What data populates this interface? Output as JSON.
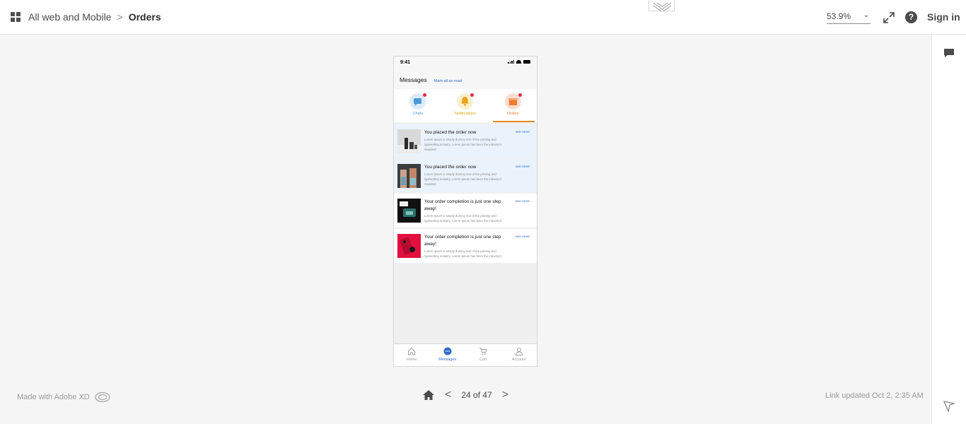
{
  "breadcrumb": {
    "project": "All web and Mobile",
    "separator": ">",
    "current": "Orders"
  },
  "toolbar": {
    "zoom": "53.9%",
    "sign_in": "Sign in",
    "help": "?"
  },
  "icons": {
    "grid": "grid-icon",
    "expand": "expand-icon",
    "help": "help-icon",
    "comment": "comment-icon",
    "flag": "flag-icon",
    "home": "home-icon",
    "collapse": "chevron-up-icon",
    "creative_cloud": "creative-cloud-icon"
  },
  "phone": {
    "time": "9:41",
    "header": {
      "title": "Messages",
      "mark_all": "Mark all as read"
    },
    "tabs": [
      {
        "label": "Chats",
        "color": "#4a9ad8",
        "bg": "#dcebf8"
      },
      {
        "label": "Notifications",
        "color": "#e8a316",
        "bg": "#fcefcc"
      },
      {
        "label": "Orders",
        "color": "#f07a2a",
        "bg": "#fbdcd4"
      }
    ],
    "items": [
      {
        "title": "You placed the order now",
        "body": "Lorem Ipsum is simply dummy text of the printing and typesetting industry. Lorem Ipsum has been the industry's standard",
        "more": "see more"
      },
      {
        "title": "You placed the order now",
        "body": "Lorem Ipsum is simply dummy text of the printing and typesetting industry. Lorem Ipsum has been the industry's standard",
        "more": "see more"
      },
      {
        "title": "Your order completion is just one step away!",
        "body": "Lorem Ipsum is simply dummy text of the printing and typesetting industry. Lorem Ipsum has been the industry's",
        "more": "see more"
      },
      {
        "title": "Your order completion is just one step away!",
        "body": "Lorem Ipsum is simply dummy text of the printing and typesetting industry. Lorem Ipsum has been the industry's",
        "more": "see more"
      }
    ],
    "tabbar": [
      {
        "label": "Home"
      },
      {
        "label": "Messages"
      },
      {
        "label": "Cart"
      },
      {
        "label": "Account"
      }
    ]
  },
  "footer": {
    "made_with": "Made with Adobe XD",
    "page_indicator": "24 of 47",
    "prev": "<",
    "next": ">",
    "updated": "Link updated Oct 2, 2:35 AM"
  },
  "colors": {
    "accent": "#2f6cc8",
    "orders_underline": "#f08a24",
    "unread_bg": "#eaf3fc",
    "badge": "#e8264a"
  }
}
